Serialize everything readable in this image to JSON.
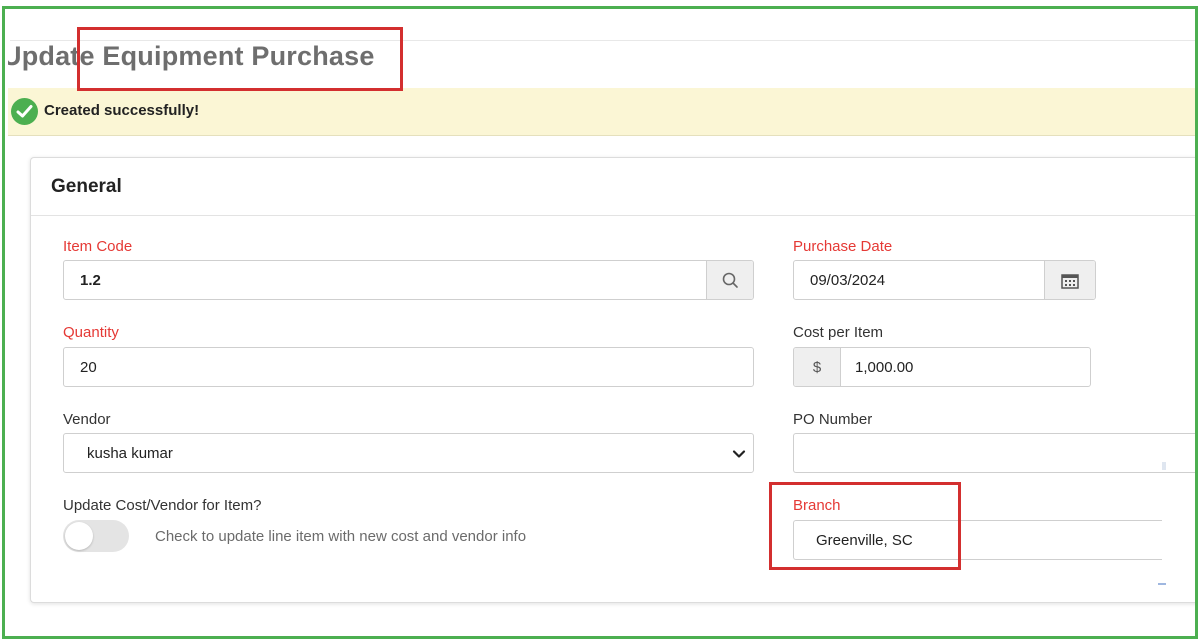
{
  "header": {
    "title": "Update Equipment Purchase"
  },
  "alert": {
    "message": "Created successfully!"
  },
  "card": {
    "title": "General",
    "fields": {
      "item_code": {
        "label": "Item Code",
        "value": "1.2"
      },
      "purchase_date": {
        "label": "Purchase Date",
        "value": "09/03/2024"
      },
      "quantity": {
        "label": "Quantity",
        "value": "20"
      },
      "cost_per_item": {
        "label": "Cost per Item",
        "prefix": "$",
        "value": "1,000.00"
      },
      "vendor": {
        "label": "Vendor",
        "selected": "kusha kumar"
      },
      "po_number": {
        "label": "PO Number",
        "value": ""
      },
      "update_cost": {
        "label": "Update Cost/Vendor for Item?",
        "hint": "Check to update line item with new cost and vendor info",
        "checked": false
      },
      "branch": {
        "label": "Branch",
        "value": "Greenville, SC"
      }
    }
  },
  "colors": {
    "required_label": "#e53935",
    "success_bg": "#fbf6d5",
    "success_icon": "#4caf50",
    "annotation_red": "#d32f2f",
    "frame_green": "#4caf50"
  },
  "icons": {
    "success": "check-circle-icon",
    "item_lookup": "search-icon",
    "date_picker": "calendar-icon",
    "vendor_dropdown": "chevron-down-icon"
  }
}
